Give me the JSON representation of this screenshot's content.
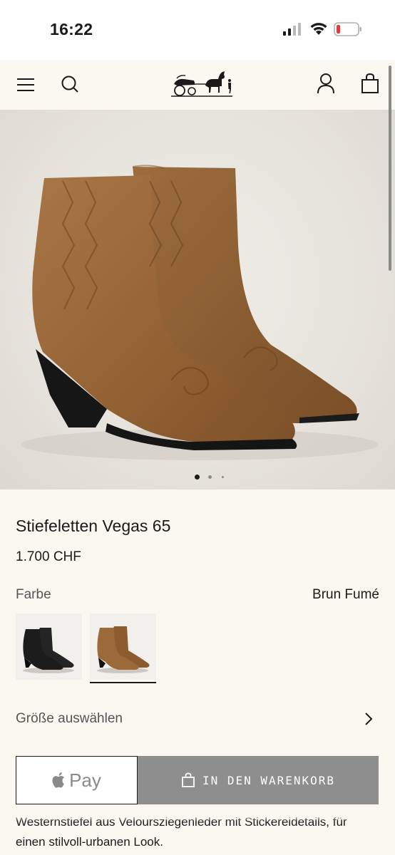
{
  "status_bar": {
    "time": "16:22"
  },
  "header": {
    "menu_icon": "hamburger-icon",
    "search_icon": "search-icon",
    "logo": "caleche-logo",
    "account_icon": "user-icon",
    "bag_icon": "shopping-bag-icon"
  },
  "carousel": {
    "image_count": 3,
    "active_index": 0
  },
  "product": {
    "name": "Stiefeletten Vegas 65",
    "price": "1.700 CHF",
    "color_label": "Farbe",
    "color_value": "Brun Fumé",
    "swatches": [
      {
        "color": "#1c1c1c",
        "selected": false
      },
      {
        "color": "#9a6a3c",
        "selected": true
      }
    ],
    "size_label": "Größe auswählen",
    "description_partial": "Westernstiefel aus Veloursziegenleder mit Stickereidetails, für",
    "description_line2": "einen stilvoll-urbanen Look."
  },
  "actions": {
    "applepay_label": "Pay",
    "cart_label": "IN DEN WARENKORB"
  },
  "colors": {
    "background": "#fbf7f1",
    "cart_button": "#8e8e8e",
    "boot_brown": "#9a6a3c"
  }
}
